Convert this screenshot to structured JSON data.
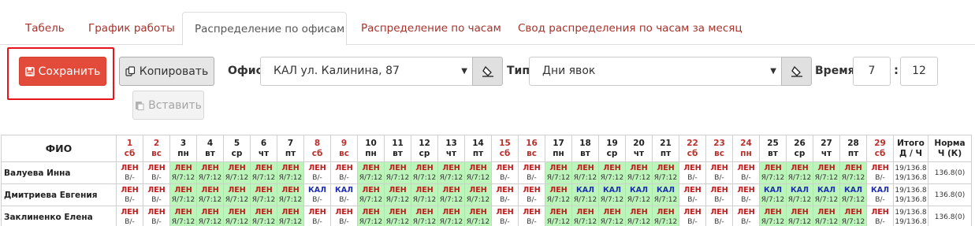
{
  "tabs": [
    {
      "label": "Табель",
      "active": false
    },
    {
      "label": "График работы",
      "active": false
    },
    {
      "label": "Распределение по офисам",
      "active": true
    },
    {
      "label": "Распределение по часам",
      "active": false
    },
    {
      "label": "Свод распределения по часам за месяц",
      "active": false
    }
  ],
  "toolbar": {
    "save_label": "Сохранить",
    "copy_label": "Копировать",
    "paste_label": "Вставить",
    "office_label": "Офис",
    "office_value": "КАЛ ул. Калинина, 87",
    "type_label": "Тип",
    "type_value": "Дни явок",
    "time_label": "Время",
    "time_from": "7",
    "time_sep": ":",
    "time_to": "12"
  },
  "colors": {
    "accent": "#e24b39",
    "weekend_text": "#b8312c",
    "work_bg": "#bcf5b9",
    "kal_text": "#1f2fb3",
    "highlight": "#e8141c"
  },
  "table": {
    "fio_header": "ФИО",
    "total_header": [
      "Итого",
      "Д / Ч"
    ],
    "norm_header": [
      "Норма",
      "Ч (К)"
    ],
    "days": [
      {
        "n": "1",
        "w": "сб",
        "weekend": true
      },
      {
        "n": "2",
        "w": "вс",
        "weekend": true
      },
      {
        "n": "3",
        "w": "пн",
        "weekend": false
      },
      {
        "n": "4",
        "w": "вт",
        "weekend": false
      },
      {
        "n": "5",
        "w": "ср",
        "weekend": false
      },
      {
        "n": "6",
        "w": "чт",
        "weekend": false
      },
      {
        "n": "7",
        "w": "пт",
        "weekend": false
      },
      {
        "n": "8",
        "w": "сб",
        "weekend": true
      },
      {
        "n": "9",
        "w": "вс",
        "weekend": true
      },
      {
        "n": "10",
        "w": "пн",
        "weekend": false
      },
      {
        "n": "11",
        "w": "вт",
        "weekend": false
      },
      {
        "n": "12",
        "w": "ср",
        "weekend": false
      },
      {
        "n": "13",
        "w": "чт",
        "weekend": false
      },
      {
        "n": "14",
        "w": "пт",
        "weekend": false
      },
      {
        "n": "15",
        "w": "сб",
        "weekend": true
      },
      {
        "n": "16",
        "w": "вс",
        "weekend": true
      },
      {
        "n": "17",
        "w": "пн",
        "weekend": false
      },
      {
        "n": "18",
        "w": "вт",
        "weekend": false
      },
      {
        "n": "19",
        "w": "ср",
        "weekend": false
      },
      {
        "n": "20",
        "w": "чт",
        "weekend": false
      },
      {
        "n": "21",
        "w": "пт",
        "weekend": false
      },
      {
        "n": "22",
        "w": "сб",
        "weekend": true
      },
      {
        "n": "23",
        "w": "вс",
        "weekend": true
      },
      {
        "n": "24",
        "w": "пн",
        "weekend": true
      },
      {
        "n": "25",
        "w": "вт",
        "weekend": false
      },
      {
        "n": "26",
        "w": "ср",
        "weekend": false
      },
      {
        "n": "27",
        "w": "чт",
        "weekend": false
      },
      {
        "n": "28",
        "w": "пт",
        "weekend": false
      },
      {
        "n": "29",
        "w": "сб",
        "weekend": true
      }
    ],
    "rows": [
      {
        "name": "Валуева Инна",
        "total": [
          "19/136.8",
          "19/136.8"
        ],
        "norm": "136.8(0)",
        "cells": [
          [
            "ЛЕН",
            "В/-"
          ],
          [
            "ЛЕН",
            "В/-"
          ],
          [
            "ЛЕН",
            "Я/7:12"
          ],
          [
            "ЛЕН",
            "Я/7:12"
          ],
          [
            "ЛЕН",
            "Я/7:12"
          ],
          [
            "ЛЕН",
            "Я/7:12"
          ],
          [
            "ЛЕН",
            "Я/7:12"
          ],
          [
            "ЛЕН",
            "В/-"
          ],
          [
            "ЛЕН",
            "В/-"
          ],
          [
            "ЛЕН",
            "Я/7:12"
          ],
          [
            "ЛЕН",
            "Я/7:12"
          ],
          [
            "ЛЕН",
            "Я/7:12"
          ],
          [
            "ЛЕН",
            "Я/7:12"
          ],
          [
            "ЛЕН",
            "Я/7:12"
          ],
          [
            "ЛЕН",
            "В/-"
          ],
          [
            "ЛЕН",
            "В/-"
          ],
          [
            "ЛЕН",
            "Я/7:12"
          ],
          [
            "ЛЕН",
            "Я/7:12"
          ],
          [
            "ЛЕН",
            "Я/7:12"
          ],
          [
            "ЛЕН",
            "Я/7:12"
          ],
          [
            "ЛЕН",
            "Я/7:12"
          ],
          [
            "ЛЕН",
            "В/-"
          ],
          [
            "ЛЕН",
            "В/-"
          ],
          [
            "ЛЕН",
            "В/-"
          ],
          [
            "ЛЕН",
            "Я/7:12"
          ],
          [
            "ЛЕН",
            "Я/7:12"
          ],
          [
            "ЛЕН",
            "Я/7:12"
          ],
          [
            "ЛЕН",
            "Я/7:12"
          ],
          [
            "ЛЕН",
            "В/-"
          ]
        ]
      },
      {
        "name": "Дмитриева Евгения",
        "total": [
          "19/136.8",
          "19/136.8"
        ],
        "norm": "136.8(0)",
        "cells": [
          [
            "ЛЕН",
            "В/-"
          ],
          [
            "ЛЕН",
            "В/-"
          ],
          [
            "ЛЕН",
            "Я/7:12"
          ],
          [
            "ЛЕН",
            "Я/7:12"
          ],
          [
            "ЛЕН",
            "Я/7:12"
          ],
          [
            "ЛЕН",
            "Я/7:12"
          ],
          [
            "ЛЕН",
            "Я/7:12"
          ],
          [
            "КАЛ",
            "В/-"
          ],
          [
            "КАЛ",
            "В/-"
          ],
          [
            "ЛЕН",
            "Я/7:12"
          ],
          [
            "ЛЕН",
            "Я/7:12"
          ],
          [
            "ЛЕН",
            "Я/7:12"
          ],
          [
            "ЛЕН",
            "Я/7:12"
          ],
          [
            "ЛЕН",
            "Я/7:12"
          ],
          [
            "ЛЕН",
            "В/-"
          ],
          [
            "ЛЕН",
            "В/-"
          ],
          [
            "ЛЕН",
            "Я/7:12"
          ],
          [
            "КАЛ",
            "Я/7:12"
          ],
          [
            "КАЛ",
            "Я/7:12"
          ],
          [
            "КАЛ",
            "Я/7:12"
          ],
          [
            "КАЛ",
            "Я/7:12"
          ],
          [
            "ЛЕН",
            "В/-"
          ],
          [
            "ЛЕН",
            "В/-"
          ],
          [
            "ЛЕН",
            "В/-"
          ],
          [
            "КАЛ",
            "Я/7:12"
          ],
          [
            "КАЛ",
            "Я/7:12"
          ],
          [
            "КАЛ",
            "Я/7:12"
          ],
          [
            "КАЛ",
            "Я/7:12"
          ],
          [
            "КАЛ",
            "В/-"
          ]
        ]
      },
      {
        "name": "Заклиненко Елена",
        "total": [
          "19/136.8",
          "19/136.8"
        ],
        "norm": "136.8(0)",
        "cells": [
          [
            "ЛЕН",
            "В/-"
          ],
          [
            "ЛЕН",
            "В/-"
          ],
          [
            "ЛЕН",
            "Я/7:12"
          ],
          [
            "ЛЕН",
            "Я/7:12"
          ],
          [
            "ЛЕН",
            "Я/7:12"
          ],
          [
            "ЛЕН",
            "Я/7:12"
          ],
          [
            "ЛЕН",
            "Я/7:12"
          ],
          [
            "ЛЕН",
            "В/-"
          ],
          [
            "ЛЕН",
            "В/-"
          ],
          [
            "ЛЕН",
            "Я/7:12"
          ],
          [
            "ЛЕН",
            "Я/7:12"
          ],
          [
            "ЛЕН",
            "Я/7:12"
          ],
          [
            "ЛЕН",
            "Я/7:12"
          ],
          [
            "ЛЕН",
            "Я/7:12"
          ],
          [
            "ЛЕН",
            "В/-"
          ],
          [
            "ЛЕН",
            "В/-"
          ],
          [
            "ЛЕН",
            "Я/7:12"
          ],
          [
            "ЛЕН",
            "Я/7:12"
          ],
          [
            "ЛЕН",
            "Я/7:12"
          ],
          [
            "ЛЕН",
            "Я/7:12"
          ],
          [
            "ЛЕН",
            "Я/7:12"
          ],
          [
            "ЛЕН",
            "В/-"
          ],
          [
            "ЛЕН",
            "В/-"
          ],
          [
            "ЛЕН",
            "В/-"
          ],
          [
            "ЛЕН",
            "Я/7:12"
          ],
          [
            "ЛЕН",
            "Я/7:12"
          ],
          [
            "ЛЕН",
            "Я/7:12"
          ],
          [
            "ЛЕН",
            "Я/7:12"
          ],
          [
            "ЛЕН",
            "В/-"
          ]
        ]
      }
    ]
  }
}
